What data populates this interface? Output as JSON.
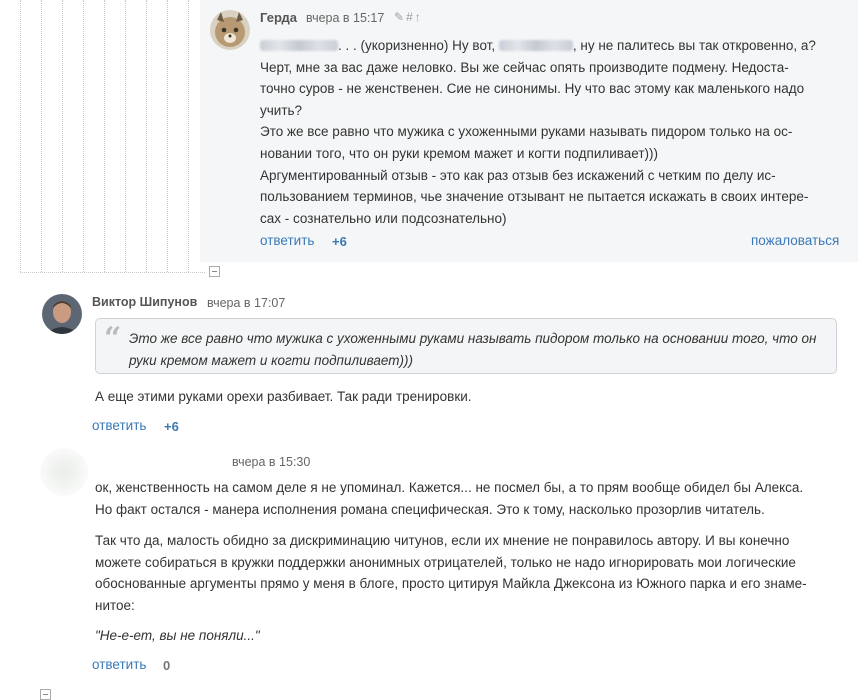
{
  "comment1": {
    "author": "Герда",
    "date": "вчера в 15:17",
    "icons": [
      "pencil-icon",
      "hash-icon",
      "up-arrow-icon"
    ],
    "lines": [
      ". . . (укоризненно) Ну вот, ",
      ", ну не палитесь вы так откровенно, а?",
      "Черт, мне за вас даже неловко. Вы же сейчас опять производите подмену.  Недоста-",
      "точно суров - не женственен. Сие не синонимы. Ну что вас этому как маленького надо",
      "учить?",
      "Это же все равно что мужика с ухоженными руками называть пидором только на ос-",
      "новании того, что он руки кремом мажет и когти подпиливает)))",
      "Аргументированный отзыв - это как раз отзыв без искажений с четким по делу  ис-",
      "пользованием терминов, чье значение отзывант не пытается искажать в своих интере-",
      "сах - сознательно или подсознательно)"
    ],
    "reply": "ответить",
    "score": "+6",
    "report": "пожаловаться"
  },
  "comment2": {
    "author": "Виктор Шипунов",
    "date": "вчера в 17:07",
    "quote_lines": [
      "Это же все равно что мужика с ухоженными руками называть пидором только  на основании того, что он",
      "руки кремом мажет и когти подпиливает)))"
    ],
    "text": "А еще этими руками орехи разбивает. Так ради тренировки.",
    "reply": "ответить",
    "score": "+6"
  },
  "comment3": {
    "date": "вчера в 15:30",
    "p1": [
      "ок, женственность на самом деле я не упоминал. Кажется... не посмел бы, а то прям вообще обидел бы Алекса.",
      "Но факт остался - манера исполнения романа специфическая. Это к тому, насколько прозорлив читатель."
    ],
    "p2": [
      "Так что да, малость обидно за дискриминацию читунов, если их мнение не понравилось автору. И вы конечно",
      "можете собираться в кружки поддержки анонимных отрицателей, только не надо игнорировать мои логические",
      "обоснованные аргументы прямо у меня в блоге, просто цитируя Майкла Джексона из Южного парка и его знаме-",
      "нитое:"
    ],
    "quote": "\"Не-е-ет, вы не поняли...\"",
    "reply": "ответить",
    "score": "0"
  },
  "colors": {
    "link": "#3a79b8",
    "comment_bg": "#f5f6f7",
    "quote_bg": "#f4f5f6"
  }
}
